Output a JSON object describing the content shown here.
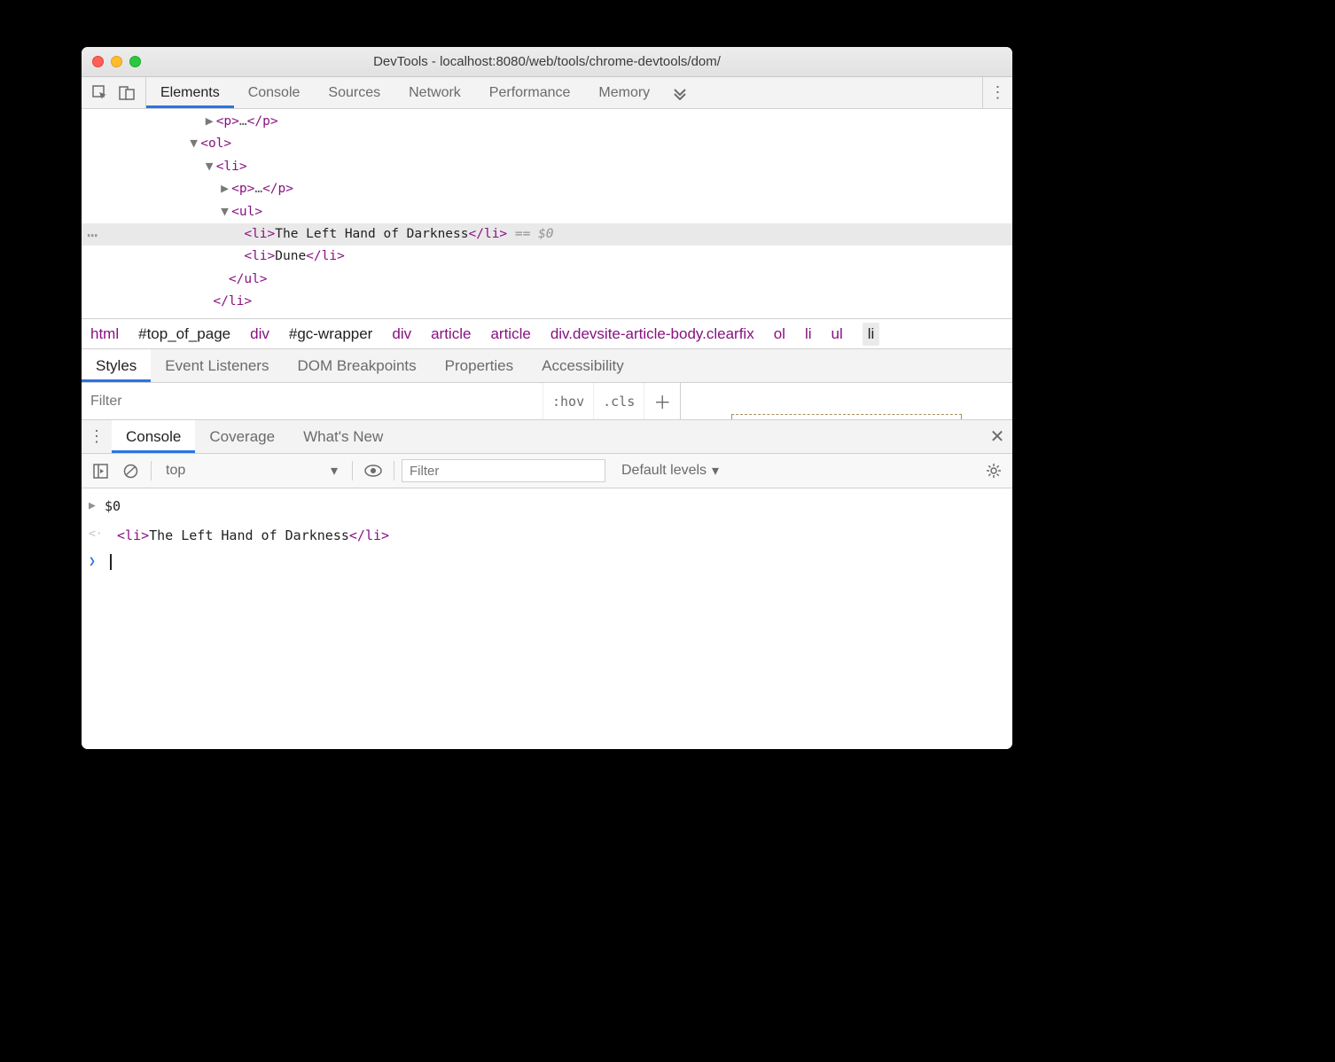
{
  "window": {
    "title": "DevTools - localhost:8080/web/tools/chrome-devtools/dom/"
  },
  "mainTabs": [
    "Elements",
    "Console",
    "Sources",
    "Network",
    "Performance",
    "Memory"
  ],
  "mainActive": "Elements",
  "dom": {
    "line1_tag_open": "<p>",
    "line1_ell": "…",
    "line1_tag_close": "</p>",
    "line2": "<ol>",
    "line3": "<li>",
    "line4_tag_open": "<p>",
    "line4_ell": "…",
    "line4_tag_close": "</p>",
    "line5": "<ul>",
    "sel_open": "<li>",
    "sel_text": "The Left Hand of Darkness",
    "sel_close": "</li>",
    "sel_ref": " == $0",
    "line7_open": "<li>",
    "line7_text": "Dune",
    "line7_close": "</li>",
    "line8": "</ul>",
    "line9": "</li>"
  },
  "breadcrumb": [
    "html",
    "#top_of_page",
    "div",
    "#gc-wrapper",
    "div",
    "article",
    "article",
    "div.devsite-article-body.clearfix",
    "ol",
    "li",
    "ul",
    "li"
  ],
  "sideTabs": [
    "Styles",
    "Event Listeners",
    "DOM Breakpoints",
    "Properties",
    "Accessibility"
  ],
  "sideActive": "Styles",
  "stylesFilter": {
    "placeholder": "Filter",
    "hov": ":hov",
    "cls": ".cls"
  },
  "drawerTabs": [
    "Console",
    "Coverage",
    "What's New"
  ],
  "drawerActive": "Console",
  "consoleToolbar": {
    "context": "top",
    "filterPlaceholder": "Filter",
    "levels": "Default levels"
  },
  "console": {
    "r1": "$0",
    "r2_open": "<li>",
    "r2_text": "The Left Hand of Darkness",
    "r2_close": "</li>"
  }
}
